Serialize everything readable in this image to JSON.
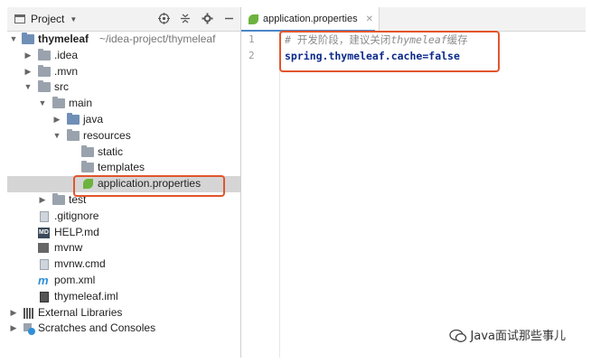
{
  "project_panel": {
    "title": "Project",
    "tools": [
      "target-icon",
      "collapse-icon",
      "settings-icon",
      "minimize-icon"
    ]
  },
  "tree": [
    {
      "name": "thymeleaf",
      "path": "~/idea-project/thymeleaf"
    },
    {
      "name": ".idea"
    },
    {
      "name": ".mvn"
    },
    {
      "name": "src"
    },
    {
      "name": "main"
    },
    {
      "name": "java"
    },
    {
      "name": "resources"
    },
    {
      "name": "static"
    },
    {
      "name": "templates"
    },
    {
      "name": "application.properties"
    },
    {
      "name": "test"
    },
    {
      "name": ".gitignore"
    },
    {
      "name": "HELP.md"
    },
    {
      "name": "mvnw"
    },
    {
      "name": "mvnw.cmd"
    },
    {
      "name": "pom.xml"
    },
    {
      "name": "thymeleaf.iml"
    },
    {
      "name": "External Libraries"
    },
    {
      "name": "Scratches and Consoles"
    }
  ],
  "editor": {
    "tab_label": "application.properties",
    "line_numbers": [
      "1",
      "2"
    ],
    "lines": {
      "comment_prefix": "# 开发阶段，建议关闭",
      "comment_italic": "thymeleaf",
      "comment_suffix": "缓存",
      "prop_key": "spring.thymeleaf.cache",
      "prop_eq": "=",
      "prop_val": "false"
    }
  },
  "watermark": {
    "text": "Java面试那些事儿"
  },
  "colors": {
    "highlight": "#e2552c",
    "selection": "#d5d5d5",
    "keyword": "#0a2a8a"
  }
}
